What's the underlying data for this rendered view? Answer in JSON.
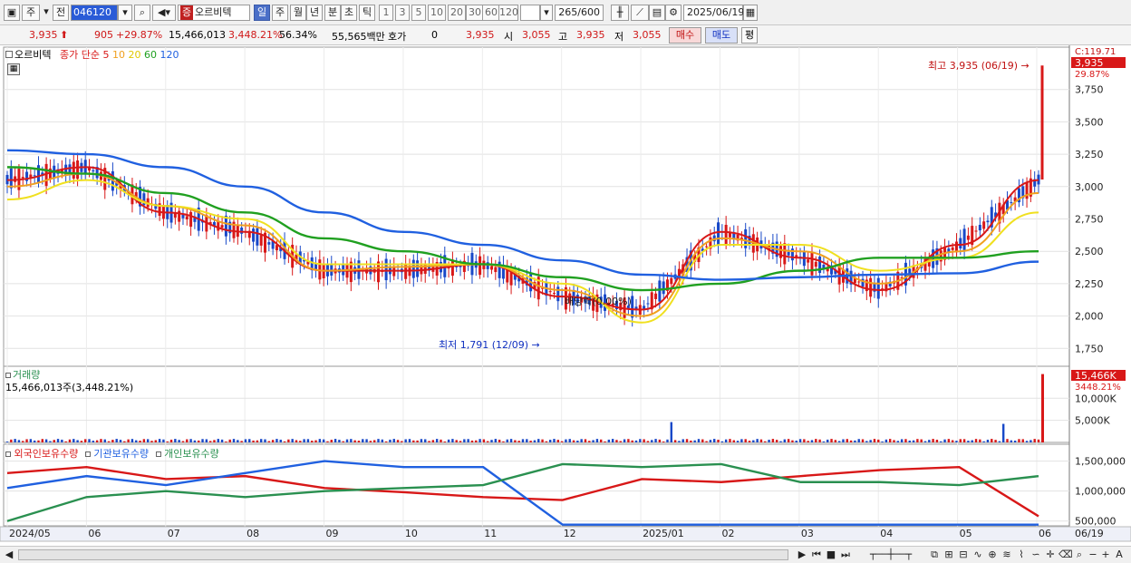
{
  "toolbar": {
    "type_label": "주",
    "prev_label": "전",
    "code": "046120",
    "stock_tag": "증",
    "stock_name": "오르비텍",
    "periods": [
      "일",
      "주",
      "월",
      "년",
      "분",
      "초",
      "틱"
    ],
    "selected_period": "일",
    "intervals": [
      "1",
      "3",
      "5",
      "10",
      "20",
      "30",
      "60",
      "120"
    ],
    "count": "265",
    "count_max": "/600",
    "date": "2025/06/19"
  },
  "quote": {
    "price": "3,935",
    "change": "905",
    "change_pct": "+29.87%",
    "volume": "15,466,013",
    "volume_pct": "3,448.21%",
    "turnover": "56.34%",
    "amount": "55,565백만",
    "hoga_label": "호가",
    "hoga_value": "0",
    "hoga_price": "3,935",
    "open_label": "시",
    "open": "3,055",
    "high_label": "고",
    "high": "3,935",
    "low_label": "저",
    "low": "3,055",
    "buy_label": "매수",
    "sell_label": "매도",
    "eval_label": "평"
  },
  "price_panel": {
    "stock_label": "오르비텍",
    "ma_label": "종가 단순",
    "ma_periods": [
      "5",
      "10",
      "20",
      "60",
      "120"
    ],
    "ma_colors": [
      "#d81818",
      "#f0a020",
      "#f0e020",
      "#20a020",
      "#2060e0"
    ],
    "y_ticks": [
      "3,750",
      "3,500",
      "3,250",
      "3,000",
      "2,750",
      "2,500",
      "2,250",
      "2,000",
      "1,750"
    ],
    "top_label": "C:119.71",
    "current_price_tag": "3,935",
    "current_pct_tag": "29.87%",
    "high_annotation": "최고 3,935 (06/19)",
    "low_annotation": "최저 1,791 (12/09)",
    "dividend_annotation": "배당락(0.00%)"
  },
  "volume_panel": {
    "title": "거래량",
    "value_label": "15,466,013주(3,448.21%)",
    "y_ticks": [
      "10,000K",
      "5,000K"
    ],
    "current_tag": "15,466K",
    "current_pct_tag": "3448.21%"
  },
  "holdings_panel": {
    "series_labels": [
      "외국인보유수량",
      "기관보유수량",
      "개인보유수량"
    ],
    "series_colors": [
      "#d81818",
      "#2060e0",
      "#2a9050"
    ],
    "y_ticks": [
      "1,500,000",
      "1,000,000",
      "500,000"
    ]
  },
  "x_axis": {
    "labels": [
      "2024/05",
      "06",
      "07",
      "08",
      "09",
      "10",
      "11",
      "12",
      "2025/01",
      "02",
      "03",
      "04",
      "05",
      "06"
    ],
    "end_label": "06/19"
  },
  "chart_data": {
    "type": "line",
    "title": "오르비텍",
    "x": [
      "2024/05",
      "06",
      "07",
      "08",
      "09",
      "10",
      "11",
      "12",
      "2025/01",
      "02",
      "03",
      "04",
      "05",
      "06"
    ],
    "ylim": [
      1750,
      3935
    ],
    "series": [
      {
        "name": "5",
        "values": [
          3050,
          3150,
          2800,
          2650,
          2350,
          2350,
          2400,
          2150,
          2050,
          2650,
          2450,
          2200,
          2550,
          3050
        ]
      },
      {
        "name": "10",
        "values": [
          3000,
          3100,
          2850,
          2700,
          2350,
          2380,
          2400,
          2200,
          2000,
          2600,
          2500,
          2250,
          2500,
          2950
        ]
      },
      {
        "name": "20",
        "values": [
          2900,
          3050,
          2850,
          2750,
          2400,
          2400,
          2400,
          2250,
          1950,
          2550,
          2550,
          2350,
          2450,
          2800
        ]
      },
      {
        "name": "60",
        "values": [
          3150,
          3100,
          2950,
          2800,
          2600,
          2500,
          2400,
          2300,
          2200,
          2250,
          2350,
          2450,
          2450,
          2500
        ]
      },
      {
        "name": "120",
        "values": [
          3280,
          3250,
          3150,
          3000,
          2800,
          2650,
          2550,
          2430,
          2320,
          2280,
          2300,
          2320,
          2330,
          2420
        ]
      }
    ],
    "high": {
      "value": 3935,
      "date": "06/19"
    },
    "low": {
      "value": 1791,
      "date": "12/09"
    }
  }
}
